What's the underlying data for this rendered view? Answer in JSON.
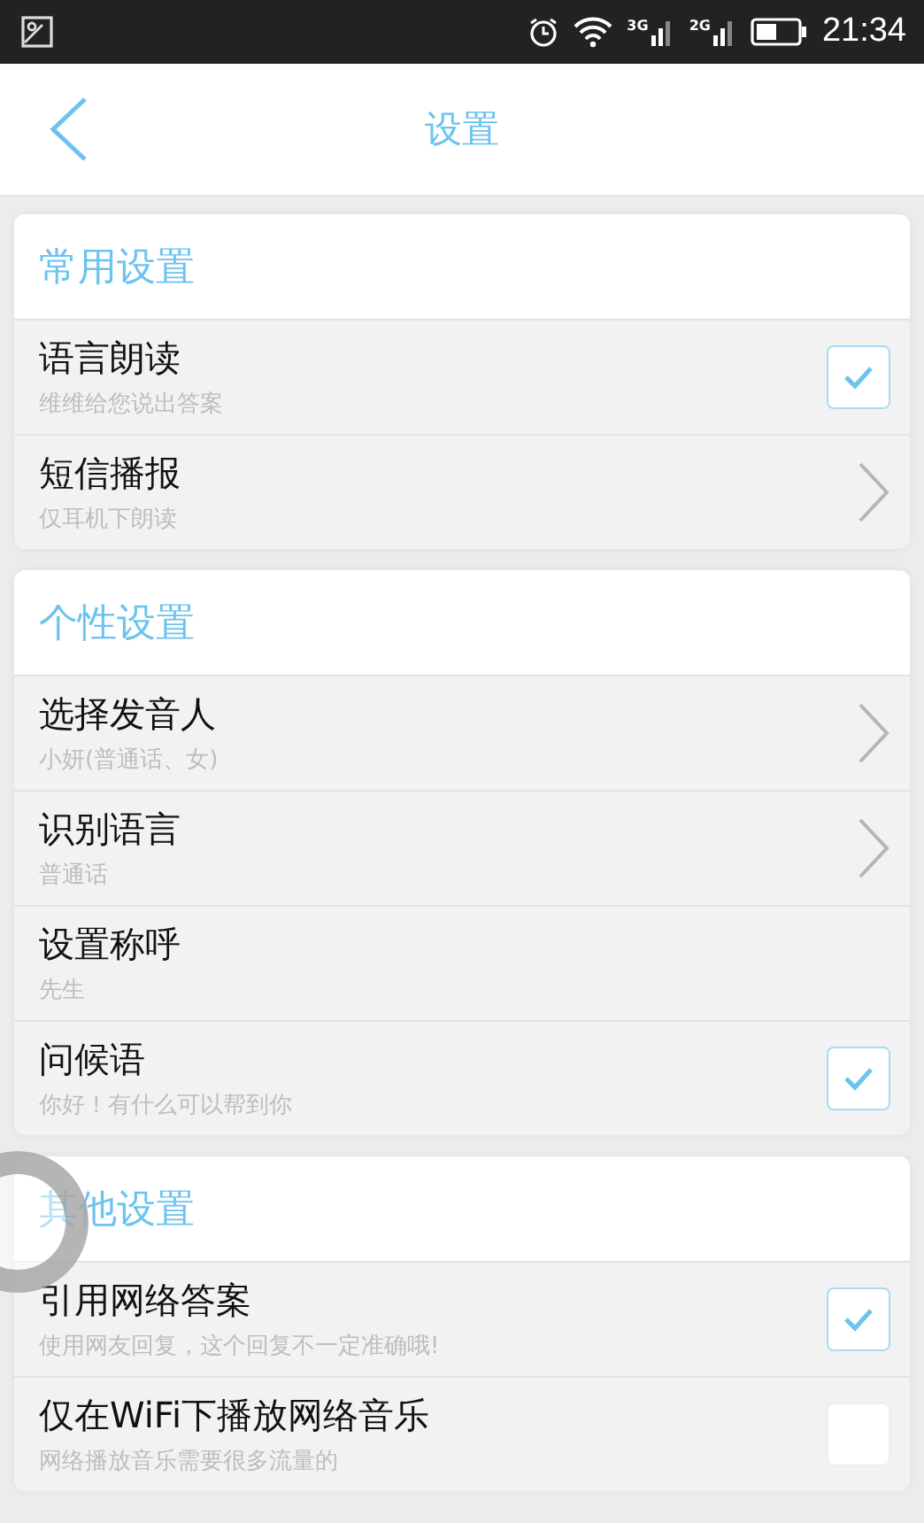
{
  "status_bar": {
    "network_labels": [
      "3G",
      "2G"
    ],
    "time": "21:34"
  },
  "header": {
    "title": "设置"
  },
  "sections": [
    {
      "title": "常用设置",
      "rows": [
        {
          "kind": "checkbox",
          "title": "语言朗读",
          "subtitle": "维维给您说出答案",
          "checked": true
        },
        {
          "kind": "link",
          "title": "短信播报",
          "subtitle": "仅耳机下朗读"
        }
      ]
    },
    {
      "title": "个性设置",
      "rows": [
        {
          "kind": "link",
          "title": "选择发音人",
          "subtitle": "小妍(普通话、女)"
        },
        {
          "kind": "link",
          "title": "识别语言",
          "subtitle": "普通话"
        },
        {
          "kind": "plain",
          "title": "设置称呼",
          "subtitle": "先生"
        },
        {
          "kind": "checkbox",
          "title": "问候语",
          "subtitle": "你好！有什么可以帮到你",
          "checked": true
        }
      ]
    },
    {
      "title": "其他设置",
      "rows": [
        {
          "kind": "checkbox",
          "title": "引用网络答案",
          "subtitle": "使用网友回复，这个回复不一定准确哦!",
          "checked": true
        },
        {
          "kind": "checkbox",
          "title": "仅在WiFi下播放网络音乐",
          "subtitle": "网络播放音乐需要很多流量的",
          "checked": false
        }
      ]
    }
  ]
}
